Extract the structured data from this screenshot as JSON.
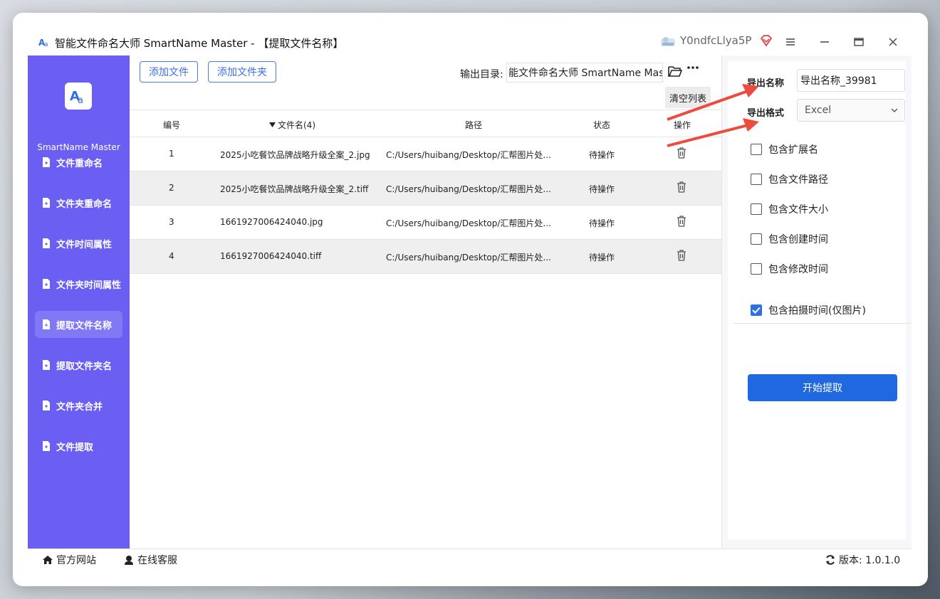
{
  "window": {
    "title": "智能文件命名大师 SmartName Master - 【提取文件名称】",
    "user_name": "Y0ndfcLlya5P"
  },
  "sidebar": {
    "brand": "SmartName Master",
    "items": [
      {
        "label": "文件重命名"
      },
      {
        "label": "文件夹重命名"
      },
      {
        "label": "文件时间属性"
      },
      {
        "label": "文件夹时间属性"
      },
      {
        "label": "提取文件名称",
        "active": true
      },
      {
        "label": "提取文件夹名"
      },
      {
        "label": "文件夹合并"
      },
      {
        "label": "文件提取"
      }
    ]
  },
  "toolbar": {
    "add_file": "添加文件",
    "add_folder": "添加文件夹",
    "output_label": "输出目录:",
    "output_value": "能文件命名大师 SmartName Master",
    "clear_list": "清空列表"
  },
  "table": {
    "headers": {
      "num": "编号",
      "name": "文件名(4)",
      "path": "路径",
      "status": "状态",
      "op": "操作"
    },
    "rows": [
      {
        "num": "1",
        "name": "2025小吃餐饮品牌战略升级全案_2.jpg",
        "path": "C:/Users/huibang/Desktop/汇帮图片处...",
        "status": "待操作"
      },
      {
        "num": "2",
        "name": "2025小吃餐饮品牌战略升级全案_2.tiff",
        "path": "C:/Users/huibang/Desktop/汇帮图片处...",
        "status": "待操作"
      },
      {
        "num": "3",
        "name": "1661927006424040.jpg",
        "path": "C:/Users/huibang/Desktop/汇帮图片处...",
        "status": "待操作"
      },
      {
        "num": "4",
        "name": "1661927006424040.tiff",
        "path": "C:/Users/huibang/Desktop/汇帮图片处...",
        "status": "待操作"
      }
    ]
  },
  "panel": {
    "export_name_label": "导出名称",
    "export_name_value": "导出名称_39981",
    "export_format_label": "导出格式",
    "export_format_value": "Excel",
    "options": [
      {
        "label": "包含扩展名",
        "checked": false
      },
      {
        "label": "包含文件路径",
        "checked": false
      },
      {
        "label": "包含文件大小",
        "checked": false
      },
      {
        "label": "包含创建时间",
        "checked": false
      },
      {
        "label": "包含修改时间",
        "checked": false
      }
    ],
    "photo_time": {
      "label": "包含拍摄时间(仅图片)",
      "checked": true
    },
    "start_button": "开始提取"
  },
  "footer": {
    "website": "官方网站",
    "service": "在线客服",
    "version": "版本: 1.0.1.0"
  },
  "colors": {
    "sidebar": "#6a5ff2",
    "accent": "#1f68e0",
    "arrow": "#ee4b3f"
  }
}
